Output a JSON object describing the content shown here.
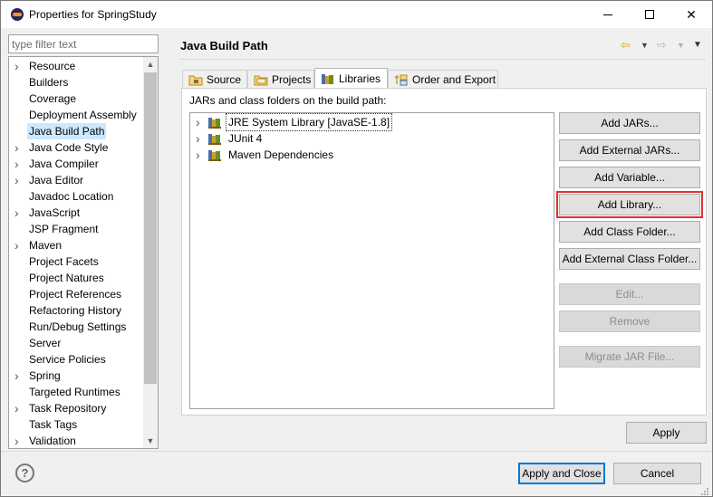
{
  "window": {
    "title": "Properties for SpringStudy",
    "minimize_icon": "minimize-icon",
    "maximize_icon": "maximize-icon",
    "close_glyph": "✕"
  },
  "sidebar": {
    "filter_placeholder": "type filter text",
    "filter_value": "",
    "selected": "Java Build Path",
    "items": [
      {
        "label": "Resource",
        "expandable": true
      },
      {
        "label": "Builders",
        "expandable": false
      },
      {
        "label": "Coverage",
        "expandable": false
      },
      {
        "label": "Deployment Assembly",
        "expandable": false
      },
      {
        "label": "Java Build Path",
        "expandable": false
      },
      {
        "label": "Java Code Style",
        "expandable": true
      },
      {
        "label": "Java Compiler",
        "expandable": true
      },
      {
        "label": "Java Editor",
        "expandable": true
      },
      {
        "label": "Javadoc Location",
        "expandable": false
      },
      {
        "label": "JavaScript",
        "expandable": true
      },
      {
        "label": "JSP Fragment",
        "expandable": false
      },
      {
        "label": "Maven",
        "expandable": true
      },
      {
        "label": "Project Facets",
        "expandable": false
      },
      {
        "label": "Project Natures",
        "expandable": false
      },
      {
        "label": "Project References",
        "expandable": false
      },
      {
        "label": "Refactoring History",
        "expandable": false
      },
      {
        "label": "Run/Debug Settings",
        "expandable": false
      },
      {
        "label": "Server",
        "expandable": false
      },
      {
        "label": "Service Policies",
        "expandable": false
      },
      {
        "label": "Spring",
        "expandable": true
      },
      {
        "label": "Targeted Runtimes",
        "expandable": false
      },
      {
        "label": "Task Repository",
        "expandable": true
      },
      {
        "label": "Task Tags",
        "expandable": false
      },
      {
        "label": "Validation",
        "expandable": true
      }
    ]
  },
  "page": {
    "title": "Java Build Path",
    "tabs": [
      {
        "label": "Source",
        "icon": "source-folder-icon",
        "active": false
      },
      {
        "label": "Projects",
        "icon": "projects-icon",
        "active": false
      },
      {
        "label": "Libraries",
        "icon": "libraries-icon",
        "active": true
      },
      {
        "label": "Order and Export",
        "icon": "order-export-icon",
        "active": false
      }
    ],
    "list_label": "JARs and class folders on the build path:",
    "libraries": [
      {
        "label": "JRE System Library [JavaSE-1.8]",
        "focused": true
      },
      {
        "label": "JUnit 4",
        "focused": false
      },
      {
        "label": "Maven Dependencies",
        "focused": false
      }
    ],
    "buttons": {
      "add_jars": "Add JARs...",
      "add_external_jars": "Add External JARs...",
      "add_variable": "Add Variable...",
      "add_library": "Add Library...",
      "add_class_folder": "Add Class Folder...",
      "add_external_class_folder": "Add External Class Folder...",
      "edit": "Edit...",
      "remove": "Remove",
      "migrate_jar": "Migrate JAR File..."
    },
    "apply": "Apply"
  },
  "footer": {
    "help": "?",
    "apply_and_close": "Apply and Close",
    "cancel": "Cancel"
  },
  "colors": {
    "selection": "#cce8ff",
    "highlight_border": "#e03030",
    "default_button_border": "#0078d7"
  }
}
